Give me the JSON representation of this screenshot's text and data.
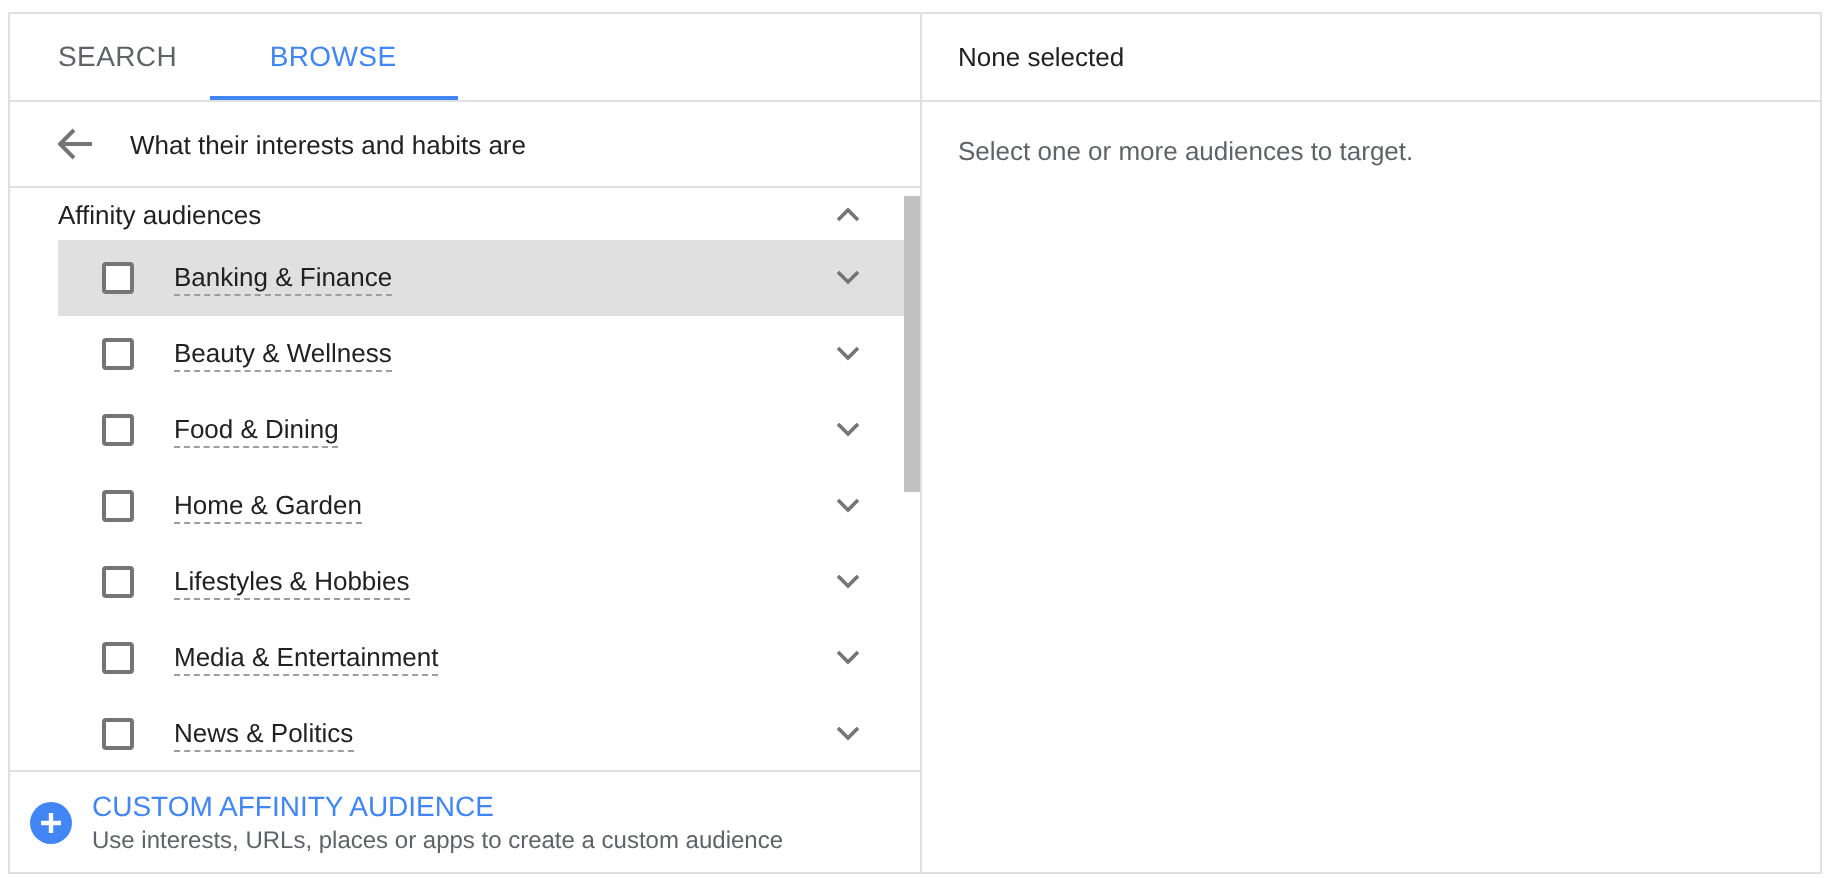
{
  "tabs": [
    {
      "label": "SEARCH",
      "selected": false
    },
    {
      "label": "BROWSE",
      "selected": true
    }
  ],
  "breadcrumb": {
    "title": "What their interests and habits are"
  },
  "group": {
    "title": "Affinity audiences",
    "expanded": true,
    "items": [
      {
        "label": "Banking & Finance",
        "checked": false,
        "expanded": false,
        "highlighted": true
      },
      {
        "label": "Beauty & Wellness",
        "checked": false,
        "expanded": false,
        "highlighted": false
      },
      {
        "label": "Food & Dining",
        "checked": false,
        "expanded": false,
        "highlighted": false
      },
      {
        "label": "Home & Garden",
        "checked": false,
        "expanded": false,
        "highlighted": false
      },
      {
        "label": "Lifestyles & Hobbies",
        "checked": false,
        "expanded": false,
        "highlighted": false
      },
      {
        "label": "Media & Entertainment",
        "checked": false,
        "expanded": false,
        "highlighted": false
      },
      {
        "label": "News & Politics",
        "checked": false,
        "expanded": false,
        "highlighted": false
      }
    ]
  },
  "custom_audience": {
    "title": "CUSTOM AFFINITY AUDIENCE",
    "description": "Use interests, URLs, places or apps to create a custom audience"
  },
  "selection_panel": {
    "title": "None selected",
    "message": "Select one or more audiences to target."
  }
}
